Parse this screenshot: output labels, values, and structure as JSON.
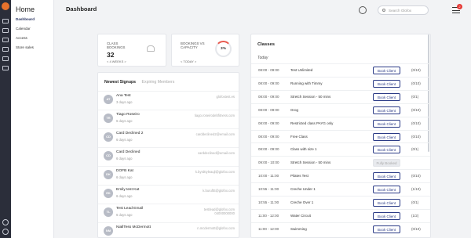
{
  "sidebar": {
    "home_title": "Home",
    "items": [
      {
        "label": "Dashboard",
        "active": true
      },
      {
        "label": "Calendar",
        "active": false
      },
      {
        "label": "Access",
        "active": false
      },
      {
        "label": "Store sales",
        "active": false
      }
    ]
  },
  "header": {
    "title": "Dashboard",
    "search_placeholder": "Search Glofox",
    "notification_count": "2"
  },
  "stats": {
    "class_bookings": {
      "label": "CLASS\nBOOKINGS",
      "value": "32",
      "period": "< 4 WEEKS >"
    },
    "capacity": {
      "label": "BOOKINGS VS\nCAPACITY",
      "value": "3%",
      "period": "< TODAY >"
    }
  },
  "signups": {
    "tab_active": "Newest Signups",
    "tab_inactive": "Expiring Members",
    "members": [
      {
        "initials": "AT",
        "name": "Ana Test",
        "ago": "3 days ago",
        "email": "glofoxtest.es"
      },
      {
        "initials": "TR",
        "name": "Tiago Roseiro",
        "ago": "6 days ago",
        "email": "tiago.roseirodebfitness.com"
      },
      {
        "initials": "CD",
        "name": "Card Declined 2",
        "ago": "6 days ago",
        "email": "carddeclined2@email.com"
      },
      {
        "initials": "CD",
        "name": "Card Declined",
        "ago": "6 days ago",
        "email": "carddeclined@email.com"
      },
      {
        "initials": "DK",
        "name": "DOFB Kat",
        "ago": "6 days ago",
        "email": "k.byrdttyleaujl@glofox.com"
      },
      {
        "initials": "EK",
        "name": "Emily test Kat",
        "ago": "6 days ago",
        "email": "k.burufttt@glofox.com"
      },
      {
        "initials": "TL",
        "name": "Test Lead Email",
        "ago": "6 days ago",
        "email": "testlead@glofox.com",
        "email2": "04000000000"
      },
      {
        "initials": "NM",
        "name": "NiallTess McDermott",
        "ago": "",
        "email": "n.mcdermott@glofox.com"
      }
    ]
  },
  "classes": {
    "title": "Classes",
    "day": "Today",
    "book_label": "Book Client",
    "full_label": "Fully Booked",
    "rows": [
      {
        "time": "08:00 - 09:00",
        "name": "Test Unlimited",
        "count": "(0/10)",
        "full": false
      },
      {
        "time": "08:00 - 09:00",
        "name": "Running with Timmy",
        "count": "(0/10)",
        "full": false
      },
      {
        "time": "08:00 - 09:00",
        "name": "Stretch Session - 50 mins",
        "count": "(0/1)",
        "full": false
      },
      {
        "time": "08:00 - 09:00",
        "name": "Grog",
        "count": "(0/10)",
        "full": false
      },
      {
        "time": "08:00 - 09:00",
        "name": "Restricted class PAYG only",
        "count": "(0/10)",
        "full": false
      },
      {
        "time": "08:00 - 09:00",
        "name": "Free Class",
        "count": "(0/10)",
        "full": false
      },
      {
        "time": "08:00 - 09:00",
        "name": "Class with size 1",
        "count": "(0/1)",
        "full": false
      },
      {
        "time": "09:00 - 10:00",
        "name": "Stretch Session - 50 mins",
        "count": "",
        "full": true
      },
      {
        "time": "10:00 - 11:00",
        "name": "Pilates Test",
        "count": "(0/10)",
        "full": false
      },
      {
        "time": "10:55 - 11:00",
        "name": "Creche Under 1",
        "count": "(1/10)",
        "full": false
      },
      {
        "time": "10:55 - 11:00",
        "name": "Creche Over 1",
        "count": "(0/1)",
        "full": false
      },
      {
        "time": "11:00 - 12:00",
        "name": "Water Circuit",
        "count": "(1/2)",
        "full": false
      },
      {
        "time": "11:00 - 12:00",
        "name": "Swimming",
        "count": "(0/10)",
        "full": false
      }
    ]
  }
}
